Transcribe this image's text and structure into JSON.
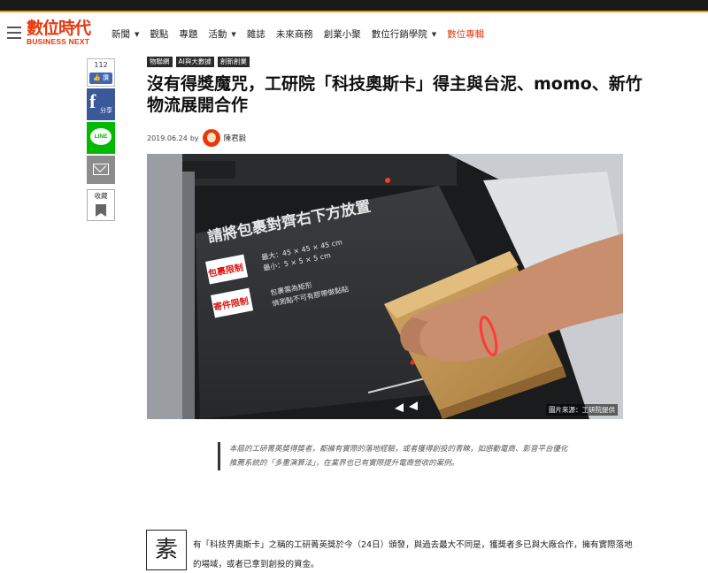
{
  "site": {
    "logo_zh": "數位時代",
    "logo_en": "BUSINESS NEXT"
  },
  "nav": {
    "items": [
      {
        "label": "新聞",
        "caret": true
      },
      {
        "label": "觀點",
        "caret": false
      },
      {
        "label": "專題",
        "caret": false
      },
      {
        "label": "活動",
        "caret": true
      },
      {
        "label": "雜誌",
        "caret": false
      },
      {
        "label": "未來商務",
        "caret": false
      },
      {
        "label": "創業小聚",
        "caret": false
      },
      {
        "label": "數位行銷學院",
        "caret": true
      },
      {
        "label": "數位專輯",
        "caret": false
      }
    ],
    "accent_color": "#e8380d"
  },
  "share": {
    "like_count": "112",
    "like_label": "讚",
    "fb_icon": "f",
    "fb_label": "分享",
    "line_label": "LINE",
    "collect_label": "收藏"
  },
  "article": {
    "tags": [
      "物聯網",
      "AI與大數據",
      "創新創業"
    ],
    "title": "沒有得獎魔咒，工研院「科技奧斯卡」得主與台泥、momo、新竹物流展開合作",
    "date": "2019.06.24",
    "by": "by",
    "author": "陳君毅",
    "image_caption": "圖片來源：工研院提供",
    "image_text": {
      "headline": "請將包裹對齊右下方放置",
      "size_max": "最大：45 × 45 × 45 cm",
      "size_min": "最小：5 × 5 × 5 cm",
      "badge1": "包裹限制",
      "badge2": "寄件限制",
      "rule1": "包裹需為矩形",
      "rule2": "偵測點不可有膠帶做黏貼"
    },
    "summary": "本屆的工研菁英獎得獎者，都擁有實際的落地經驗，或者獲得創投的青睞，如感動電商、影音平台優化推薦系統的「多重演算法」，在業界也已有實際提升電商營收的案例。",
    "dropcap": "素",
    "body": "有「科技界奧斯卡」之稱的工研菁英獎於今（24日）頒發，與過去最大不同是，獲獎者多已與大廠合作，擁有實際落地的場域，或者已拿到創投的資金。"
  }
}
